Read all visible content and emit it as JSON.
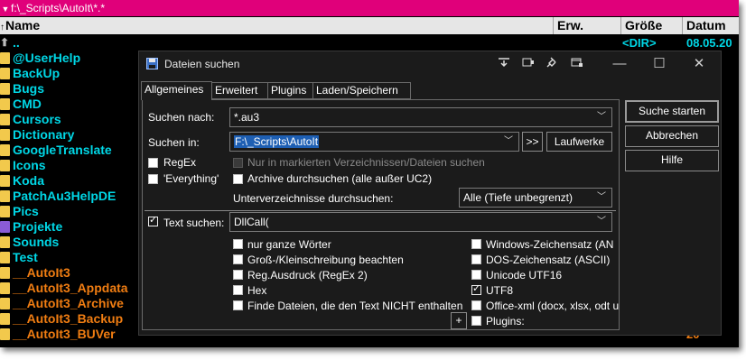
{
  "pathbar": {
    "path": "f:\\_Scripts\\AutoIt\\*.*"
  },
  "columns": {
    "name": "Name",
    "ext": "Erw.",
    "size": "Größe",
    "date": "Datum"
  },
  "files": [
    {
      "name": "..",
      "size": "<DIR>",
      "date": "08.05.20",
      "kind": "up",
      "color": "cyan"
    },
    {
      "name": "@UserHelp",
      "size": "",
      "date": "20",
      "kind": "folder",
      "color": "cyan"
    },
    {
      "name": "BackUp",
      "size": "",
      "date": "20",
      "kind": "folder",
      "color": "cyan"
    },
    {
      "name": "Bugs",
      "size": "",
      "date": "20",
      "kind": "folder",
      "color": "cyan"
    },
    {
      "name": "CMD",
      "size": "",
      "date": "20",
      "kind": "folder",
      "color": "cyan"
    },
    {
      "name": "Cursors",
      "size": "",
      "date": "20",
      "kind": "folder",
      "color": "cyan"
    },
    {
      "name": "Dictionary",
      "size": "",
      "date": "20",
      "kind": "folder",
      "color": "cyan"
    },
    {
      "name": "GoogleTranslate",
      "size": "",
      "date": "20",
      "kind": "folder",
      "color": "cyan"
    },
    {
      "name": "Icons",
      "size": "",
      "date": "20",
      "kind": "folder",
      "color": "cyan"
    },
    {
      "name": "Koda",
      "size": "",
      "date": "20",
      "kind": "folder",
      "color": "cyan"
    },
    {
      "name": "PatchAu3HelpDE",
      "size": "",
      "date": "20",
      "kind": "folder",
      "color": "cyan"
    },
    {
      "name": "Pics",
      "size": "",
      "date": "20",
      "kind": "folder",
      "color": "cyan"
    },
    {
      "name": "Projekte",
      "size": "",
      "date": "20",
      "kind": "folder-purple",
      "color": "cyan"
    },
    {
      "name": "Sounds",
      "size": "",
      "date": "20",
      "kind": "folder",
      "color": "cyan"
    },
    {
      "name": "Test",
      "size": "",
      "date": "20",
      "kind": "folder",
      "color": "cyan"
    },
    {
      "name": "__AutoIt3",
      "size": "",
      "date": "20",
      "kind": "folder",
      "color": "orange"
    },
    {
      "name": "__AutoIt3_Appdata",
      "size": "",
      "date": "20",
      "kind": "folder",
      "color": "orange"
    },
    {
      "name": "__AutoIt3_Archive",
      "size": "",
      "date": "20",
      "kind": "folder",
      "color": "orange"
    },
    {
      "name": "__AutoIt3_Backup",
      "size": "",
      "date": "20",
      "kind": "folder",
      "color": "orange"
    },
    {
      "name": "__AutoIt3_BUVer",
      "size": "",
      "date": "20",
      "kind": "folder",
      "color": "orange"
    }
  ],
  "dialog": {
    "title": "Dateien suchen",
    "tabs": [
      "Allgemeines",
      "Erweitert",
      "Plugins",
      "Laden/Speichern"
    ],
    "active_tab": "Allgemeines",
    "search_for_label": "Suchen nach:",
    "search_for_value": "*.au3",
    "search_in_label": "Suchen in:",
    "search_in_value": "F:\\_Scripts\\AutoIt",
    "arrows_button": ">>",
    "drives_button": "Laufwerke",
    "regex_label": "RegEx",
    "everything_label": "'Everything'",
    "only_marked_label": "Nur in markierten Verzeichnissen/Dateien suchen",
    "archives_label": "Archive durchsuchen (alle außer UC2)",
    "subdirs_label": "Unterverzeichnisse durchsuchen:",
    "subdirs_value": "Alle (Tiefe unbegrenzt)",
    "text_search_label": "Text suchen:",
    "text_search_value": "DllCall(",
    "opt_whole_words": "nur ganze Wörter",
    "opt_case": "Groß-/Kleinschreibung beachten",
    "opt_regex2": "Reg.Ausdruck (RegEx 2)",
    "opt_hex": "Hex",
    "opt_not_contain": "Finde Dateien, die den Text NICHT enthalten",
    "opt_windows_charset": "Windows-Zeichensatz (AN",
    "opt_dos_charset": "DOS-Zeichensatz (ASCII)",
    "opt_utf16": "Unicode UTF16",
    "opt_utf8": "UTF8",
    "opt_officexml": "Office-xml (docx, xlsx, odt u",
    "opt_plugins": "Plugins:",
    "plus_button": "+",
    "start_button": "Suche starten",
    "cancel_button": "Abbrechen",
    "help_button": "Hilfe"
  },
  "colors": {
    "pathbar": "#e0007a",
    "cyan": "#00d7e6",
    "orange": "#f07d12",
    "dialog_bg": "#1b1b1b"
  }
}
